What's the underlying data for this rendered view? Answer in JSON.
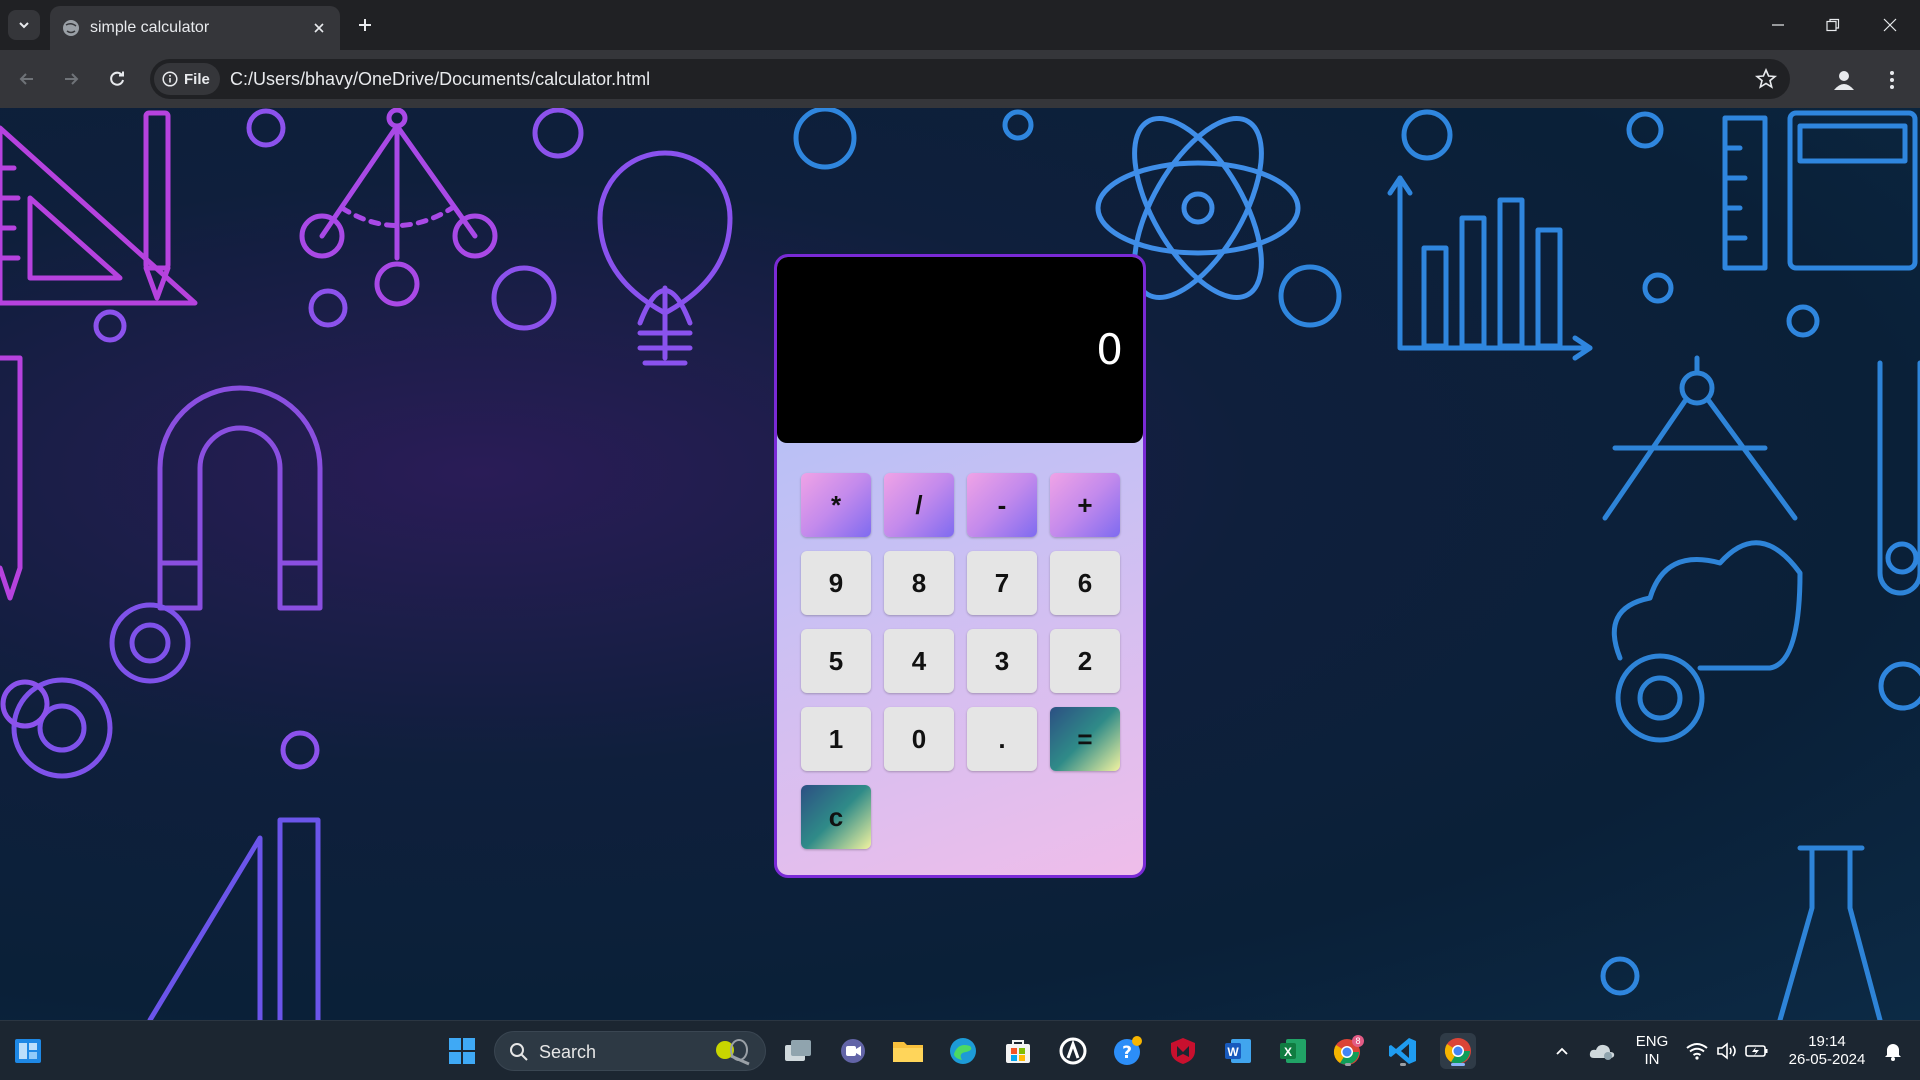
{
  "browser": {
    "tab_title": "simple calculator",
    "file_chip_label": "File",
    "url": "C:/Users/bhavy/OneDrive/Documents/calculator.html"
  },
  "calculator": {
    "display": "0",
    "keys": {
      "multiply": "*",
      "divide": "/",
      "subtract": "-",
      "add": "+",
      "nine": "9",
      "eight": "8",
      "seven": "7",
      "six": "6",
      "five": "5",
      "four": "4",
      "three": "3",
      "two": "2",
      "one": "1",
      "zero": "0",
      "decimal": ".",
      "equals": "=",
      "clear": "c"
    },
    "colors": {
      "border": "#7a2ad6",
      "display_bg": "#000000",
      "number_key": "#e5e5e5"
    }
  },
  "taskbar": {
    "search_label": "Search",
    "chrome_badge": "8",
    "language": "ENG",
    "region": "IN",
    "time": "19:14",
    "date": "26-05-2024"
  }
}
